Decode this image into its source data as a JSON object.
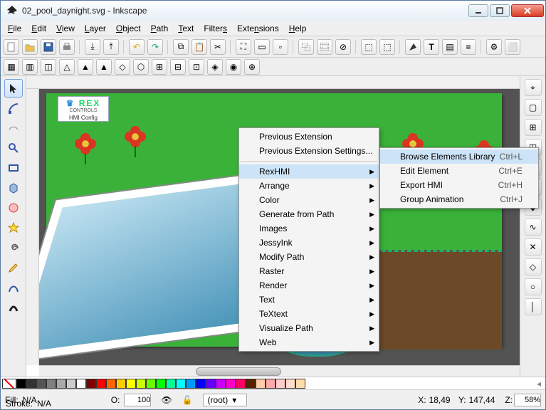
{
  "window": {
    "title": "02_pool_daynight.svg - Inkscape"
  },
  "menubar": [
    "File",
    "Edit",
    "View",
    "Layer",
    "Object",
    "Path",
    "Text",
    "Filters",
    "Extensions",
    "Help"
  ],
  "extensions_menu": {
    "items": [
      {
        "label": "Previous Extension"
      },
      {
        "label": "Previous Extension Settings..."
      },
      {
        "sep": true
      },
      {
        "label": "RexHMI",
        "sub": true,
        "hi": true
      },
      {
        "label": "Arrange",
        "sub": true
      },
      {
        "label": "Color",
        "sub": true
      },
      {
        "label": "Generate from Path",
        "sub": true
      },
      {
        "label": "Images",
        "sub": true
      },
      {
        "label": "JessyInk",
        "sub": true
      },
      {
        "label": "Modify Path",
        "sub": true
      },
      {
        "label": "Raster",
        "sub": true
      },
      {
        "label": "Render",
        "sub": true
      },
      {
        "label": "Text",
        "sub": true
      },
      {
        "label": "TeXtext",
        "sub": true
      },
      {
        "label": "Visualize Path",
        "sub": true
      },
      {
        "label": "Web",
        "sub": true
      }
    ]
  },
  "rexhmi_menu": {
    "items": [
      {
        "label": "Browse Elements Library",
        "shortcut": "Ctrl+L",
        "hi": true
      },
      {
        "label": "Edit Element",
        "shortcut": "Ctrl+E"
      },
      {
        "label": "Export HMI",
        "shortcut": "Ctrl+H"
      },
      {
        "label": "Group Animation",
        "shortcut": "Ctrl+J"
      }
    ]
  },
  "rex_badge": {
    "brand": "REX",
    "brand_sub": "CONTROLS",
    "caption": "HMI Config"
  },
  "status": {
    "fill_label": "Fill:",
    "fill_value": "N/A",
    "stroke_label": "Stroke:",
    "stroke_value": "N/A",
    "opacity_label": "O:",
    "opacity_value": "100",
    "layer_value": "(root)",
    "x_label": "X:",
    "x_value": "18,49",
    "y_label": "Y:",
    "y_value": "147,44",
    "z_label": "Z:",
    "zoom_value": "58%"
  },
  "palette": [
    "#000000",
    "#333333",
    "#555555",
    "#808080",
    "#aaaaaa",
    "#cccccc",
    "#ffffff",
    "#800000",
    "#ff0000",
    "#ff6600",
    "#ffcc00",
    "#ffff00",
    "#ccff00",
    "#66ff00",
    "#00ff00",
    "#00ff99",
    "#00ffff",
    "#0099ff",
    "#0000ff",
    "#6600ff",
    "#cc00ff",
    "#ff00cc",
    "#ff0066",
    "#552200",
    "#ffccaa",
    "#ffaaaa",
    "#ffcccc",
    "#ffddcc",
    "#ffddaa"
  ]
}
